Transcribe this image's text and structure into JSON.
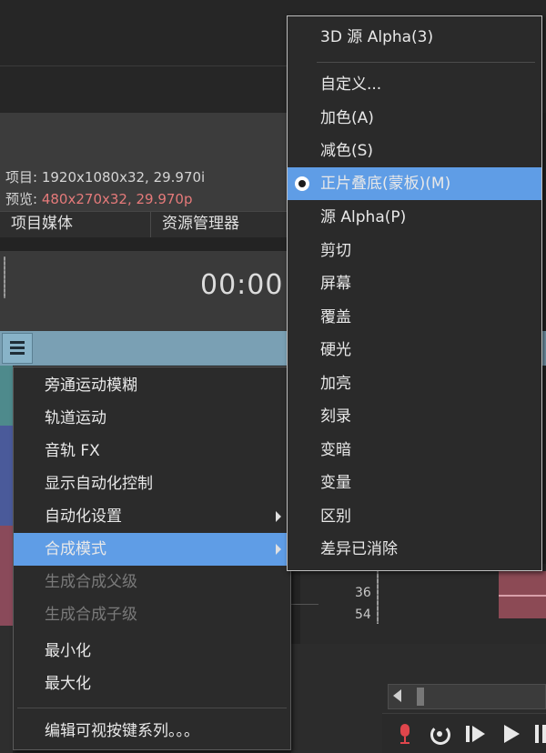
{
  "window": {
    "info": {
      "project_label": "项目:",
      "project_value": "1920x1080x32, 29.970i",
      "preview_label": "预览:",
      "preview_value": "480x270x32, 29.970p"
    },
    "tabs": [
      {
        "label": "项目媒体"
      },
      {
        "label": "资源管理器"
      }
    ],
    "time_display": "00:00:",
    "ruler_labels": [
      "36",
      "54"
    ]
  },
  "context_menu": {
    "items": [
      {
        "label": "旁通运动模糊",
        "disabled": false
      },
      {
        "label": "轨道运动",
        "disabled": false
      },
      {
        "label": "音轨 FX",
        "disabled": false
      },
      {
        "label": "显示自动化控制",
        "disabled": false
      },
      {
        "label": "自动化设置",
        "disabled": false,
        "submenu": true
      },
      {
        "label": "合成模式",
        "disabled": false,
        "submenu": true,
        "highlighted": true
      },
      {
        "label": "生成合成父级",
        "disabled": true
      },
      {
        "label": "生成合成子级",
        "disabled": true
      },
      {
        "label": "最小化",
        "disabled": false
      },
      {
        "label": "最大化",
        "disabled": false
      },
      {
        "label": "编辑可视按键系列。。。",
        "disabled": false
      }
    ]
  },
  "composite_submenu": {
    "items": [
      {
        "label": "3D 源 Alpha(3)"
      },
      {
        "label": "自定义..."
      },
      {
        "label": "加色(A)"
      },
      {
        "label": "减色(S)"
      },
      {
        "label": "正片叠底(蒙板)(M)",
        "selected": true
      },
      {
        "label": "源 Alpha(P)"
      },
      {
        "label": "剪切"
      },
      {
        "label": "屏幕"
      },
      {
        "label": "覆盖"
      },
      {
        "label": "硬光"
      },
      {
        "label": "加亮"
      },
      {
        "label": "刻录"
      },
      {
        "label": "变暗"
      },
      {
        "label": "变量"
      },
      {
        "label": "区别"
      },
      {
        "label": "差异已消除"
      }
    ]
  },
  "colors": {
    "highlight": "#5f9de6",
    "track_header": "#7aa0b4",
    "preview_value": "#e57a7a",
    "record": "#e0464c"
  },
  "icons": [
    "hamburger-icon",
    "record-icon",
    "loop-icon",
    "play-from-start-icon",
    "play-icon",
    "pause-icon",
    "submenu-arrow-icon",
    "radio-selected-icon"
  ]
}
